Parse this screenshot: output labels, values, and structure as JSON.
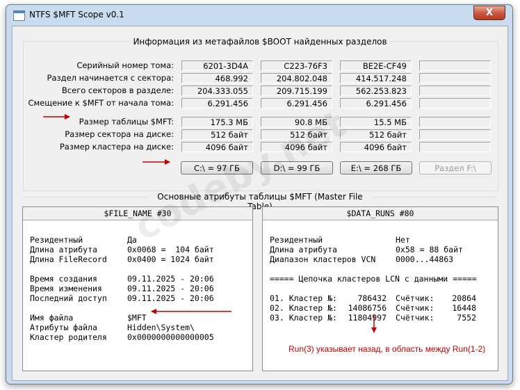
{
  "window": {
    "title": "NTFS $MFT Scope v0.1",
    "close_label": "X"
  },
  "boot_group": {
    "title": "Информация из метафайлов $BOOT найденных разделов",
    "rows": [
      {
        "label": "Серийный номер тома:",
        "values": [
          "6201-3D4A",
          "C223-76F3",
          "BE2E-CF49",
          ""
        ]
      },
      {
        "label": "Раздел начинается с сектора:",
        "values": [
          "468.992",
          "204.802.048",
          "414.517.248",
          ""
        ]
      },
      {
        "label": "Всего секторов в разделе:",
        "values": [
          "204.333.055",
          "209.715.199",
          "562.253.823",
          ""
        ]
      },
      {
        "label": "Смещение к $MFT от начала тома:",
        "values": [
          "6.291.456",
          "6.291.456",
          "6.291.456",
          ""
        ]
      },
      {
        "label": "Размер таблицы $MFT:",
        "values": [
          "175.3 МБ",
          "90.8 МБ",
          "15.5 МБ",
          ""
        ]
      },
      {
        "label": "Размер сектора на диске:",
        "values": [
          "512 байт",
          "512 байт",
          "512 байт",
          ""
        ]
      },
      {
        "label": "Размер кластера на диске:",
        "values": [
          "4096 байт",
          "4096 байт",
          "4096 байт",
          ""
        ]
      }
    ],
    "buttons": [
      "C:\\ = 97 ГБ",
      "D:\\ = 99 ГБ",
      "E:\\ = 268 ГБ",
      "Раздел F:\\"
    ]
  },
  "mft_group": {
    "title": "Основные атрибуты таблицы $MFT (Master File Table)"
  },
  "file_name_panel": {
    "header": "$FILE_NAME #30",
    "rows": [
      {
        "k": "Резидентный",
        "v": "Да"
      },
      {
        "k": "Длина атрибута",
        "v": "0x0068 =  104 байт"
      },
      {
        "k": "Длина FileRecord",
        "v": "0x0400 = 1024 байт"
      },
      {
        "k": "Время создания",
        "v": "09.11.2025 - 20:06"
      },
      {
        "k": "Время изменения",
        "v": "09.11.2025 - 20:06"
      },
      {
        "k": "Последний доступ",
        "v": "09.11.2025 - 20:06"
      },
      {
        "k": "Имя файла",
        "v": "$MFT"
      },
      {
        "k": "Атрибуты файла",
        "v": "Hidden\\System\\"
      },
      {
        "k": "Кластер родителя",
        "v": "0x0000000000000005"
      }
    ]
  },
  "data_runs_panel": {
    "header": "$DATA_RUNS #80",
    "rows": [
      {
        "k": "Резидентный",
        "v": "Нет"
      },
      {
        "k": "Длина атрибута",
        "v": "0x58 = 88 байт"
      },
      {
        "k": "Диапазон кластеров VCN",
        "v": "0000...44863"
      }
    ],
    "chain_title": "===== Цепочка кластеров LCN с данными =====",
    "clusters": [
      {
        "n": "01. Кластер №:",
        "lcn": "786432",
        "count_label": "Счётчик:",
        "count": "20864"
      },
      {
        "n": "02. Кластер №:",
        "lcn": "14086756",
        "count_label": "Счётчик:",
        "count": "16448"
      },
      {
        "n": "03. Кластер №:",
        "lcn": "11804997",
        "count_label": "Счётчик:",
        "count": "7552"
      }
    ],
    "annotation": "Run(3) указывает назад, в область между Run(1-2)"
  },
  "watermark": "codeby.net",
  "colors": {
    "annotation": "#c00000",
    "window_frame": "#c9dbee",
    "close": "#c75a44"
  },
  "icons": [
    "window-icon",
    "close-icon",
    "arrow-right-icon",
    "arrow-left-icon",
    "arrow-down-icon"
  ]
}
